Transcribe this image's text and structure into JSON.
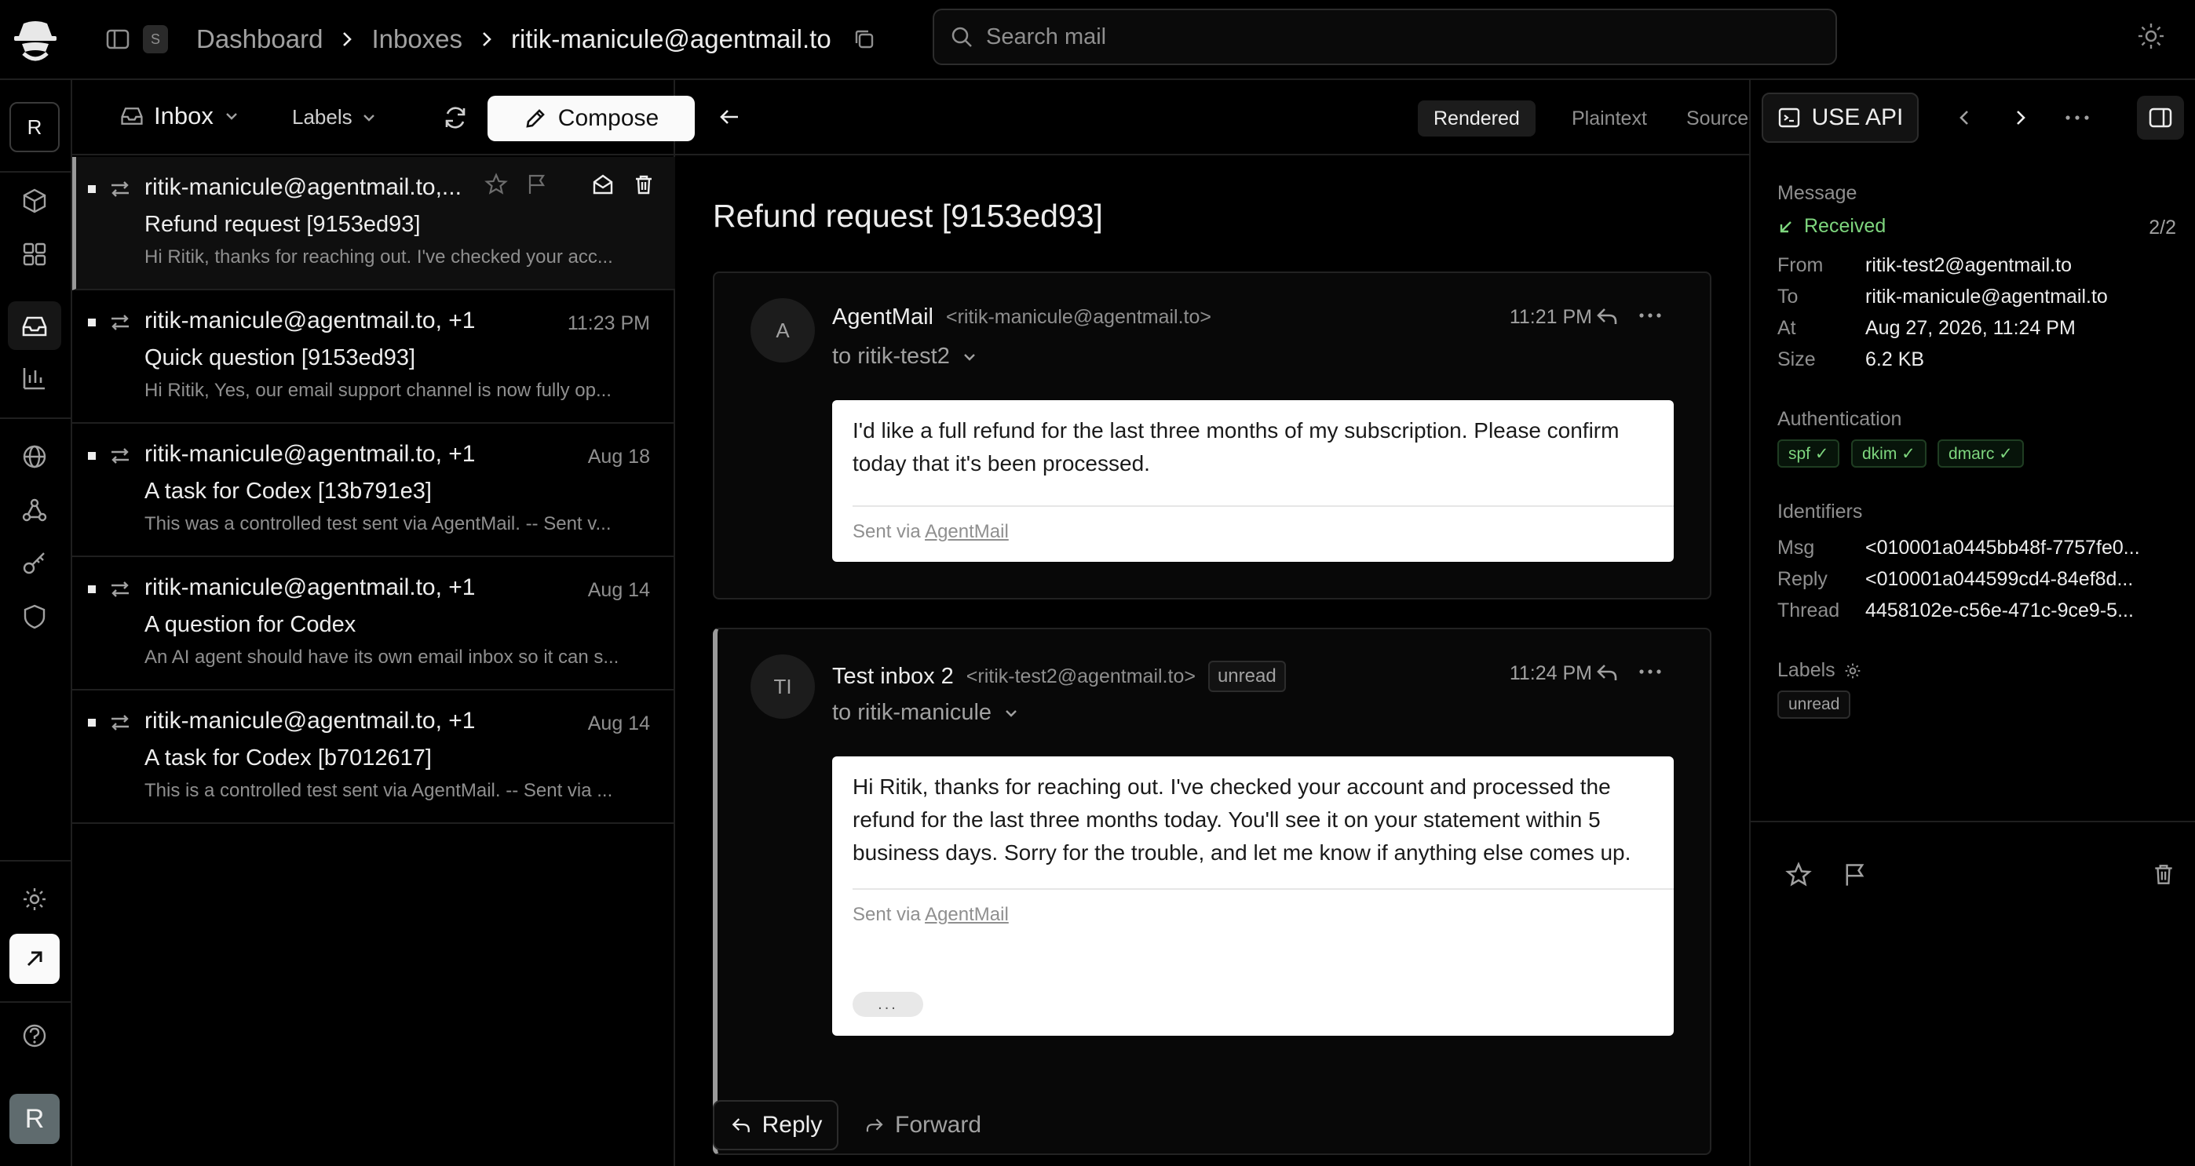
{
  "breadcrumb": {
    "workspace_key": "S",
    "items": [
      "Dashboard",
      "Inboxes"
    ],
    "current": "ritik-manicule@agentmail.to"
  },
  "search": {
    "placeholder": "Search mail"
  },
  "rail": {
    "org_initial": "R",
    "user_initial": "R"
  },
  "list_toolbar": {
    "inbox_label": "Inbox",
    "labels_label": "Labels",
    "compose_label": "Compose"
  },
  "mail_list": [
    {
      "from": "ritik-manicule@agentmail.to,...",
      "time": "",
      "subject": "Refund request [9153ed93]",
      "preview": "Hi Ritik, thanks for reaching out. I've checked your acc..."
    },
    {
      "from": "ritik-manicule@agentmail.to, +1",
      "time": "11:23 PM",
      "subject": "Quick question [9153ed93]",
      "preview": "Hi Ritik, Yes, our email support channel is now fully op..."
    },
    {
      "from": "ritik-manicule@agentmail.to, +1",
      "time": "Aug 18",
      "subject": "A task for Codex [13b791e3]",
      "preview": "This was a controlled test sent via AgentMail. -- Sent v..."
    },
    {
      "from": "ritik-manicule@agentmail.to, +1",
      "time": "Aug 14",
      "subject": "A question for Codex",
      "preview": "An AI agent should have its own email inbox so it can s..."
    },
    {
      "from": "ritik-manicule@agentmail.to, +1",
      "time": "Aug 14",
      "subject": "A task for Codex [b7012617]",
      "preview": "This is a controlled test sent via AgentMail. -- Sent via ..."
    }
  ],
  "reader_toolbar": {
    "tabs": [
      "Rendered",
      "Plaintext",
      "Source"
    ],
    "api_label": "USE API"
  },
  "thread": {
    "subject": "Refund request [9153ed93]",
    "messages": [
      {
        "avatar": "A",
        "name": "AgentMail",
        "address": "<ritik-manicule@agentmail.to>",
        "badge": "",
        "to": "to ritik-test2",
        "time": "11:21 PM",
        "body": "I'd like a full refund for the last three months of my subscription. Please confirm today that it's been processed.",
        "sig_prefix": "Sent via",
        "sig_link": "AgentMail"
      },
      {
        "avatar": "TI",
        "name": "Test inbox 2",
        "address": "<ritik-test2@agentmail.to>",
        "badge": "unread",
        "to": "to ritik-manicule",
        "time": "11:24 PM",
        "body": "Hi Ritik, thanks for reaching out. I've checked your account and processed the refund for the last three months today. You'll see it on your statement within 5 business days. Sorry for the trouble, and let me know if anything else comes up.",
        "sig_prefix": "Sent via",
        "sig_link": "AgentMail",
        "ellipsis": "..."
      }
    ],
    "reply_label": "Reply",
    "forward_label": "Forward"
  },
  "details": {
    "message_title": "Message",
    "status": "Received",
    "count": "2/2",
    "from_k": "From",
    "from_v": "ritik-test2@agentmail.to",
    "to_k": "To",
    "to_v": "ritik-manicule@agentmail.to",
    "at_k": "At",
    "at_v": "Aug 27, 2026, 11:24 PM",
    "size_k": "Size",
    "size_v": "6.2 KB",
    "auth_title": "Authentication",
    "auth_chips": [
      "spf ✓",
      "dkim ✓",
      "dmarc ✓"
    ],
    "ids_title": "Identifiers",
    "msg_k": "Msg",
    "msg_v": "<010001a0445bb48f-7757fe0...",
    "reply_k": "Reply",
    "reply_v": "<010001a044599cd4-84ef8d...",
    "thread_k": "Thread",
    "thread_v": "4458102e-c56e-471c-9ce9-5...",
    "labels_title": "Labels",
    "label_chip": "unread"
  },
  "colors": {
    "accent_green": "#7ed67e",
    "background": "#000000",
    "border": "#1f1f1f"
  }
}
